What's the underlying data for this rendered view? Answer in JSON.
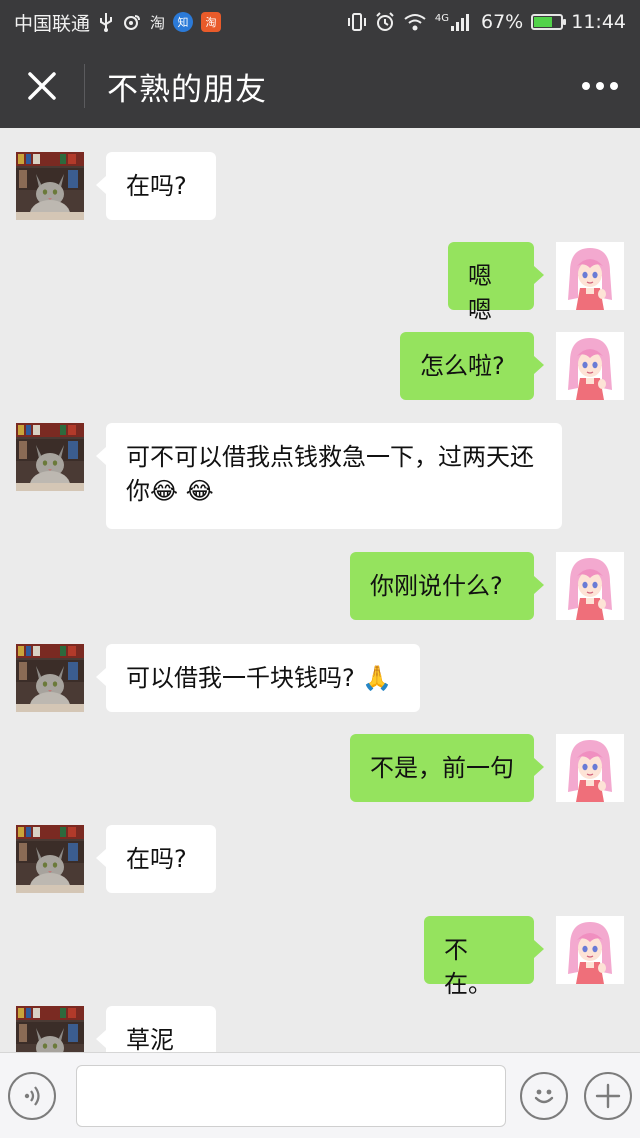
{
  "status_bar": {
    "carrier": "中国联通",
    "usb_icon": "usb-icon",
    "app_badge_1": "淘",
    "app_badge_2": "知",
    "app_badge_3": "淘",
    "network": "4G",
    "battery_percent": "67%",
    "battery_level": 0.67,
    "time": "11:44"
  },
  "header": {
    "title": "不熟的朋友",
    "close_icon": "close-icon",
    "more_icon": "more-icon"
  },
  "colors": {
    "header_bg": "#3a3a3c",
    "chat_bg": "#ebebeb",
    "sent_bubble": "#95e35e",
    "received_bubble": "#ffffff"
  },
  "messages": [
    {
      "side": "left",
      "text": "在吗?"
    },
    {
      "side": "right",
      "text": "嗯嗯"
    },
    {
      "side": "right",
      "text": "怎么啦?"
    },
    {
      "side": "left",
      "text": "可不可以借我点钱救急一下，过两天还你😂 😂"
    },
    {
      "side": "right",
      "text": "你刚说什么?"
    },
    {
      "side": "left",
      "text": "可以借我一千块钱吗? 🙏"
    },
    {
      "side": "right",
      "text": "不是，前一句"
    },
    {
      "side": "left",
      "text": "在吗?"
    },
    {
      "side": "right",
      "text": "不在。"
    },
    {
      "side": "left",
      "text": "草泥马"
    }
  ],
  "input_bar": {
    "voice_icon": "voice-icon",
    "emoji_icon": "emoji-icon",
    "plus_icon": "plus-icon",
    "input_value": ""
  }
}
